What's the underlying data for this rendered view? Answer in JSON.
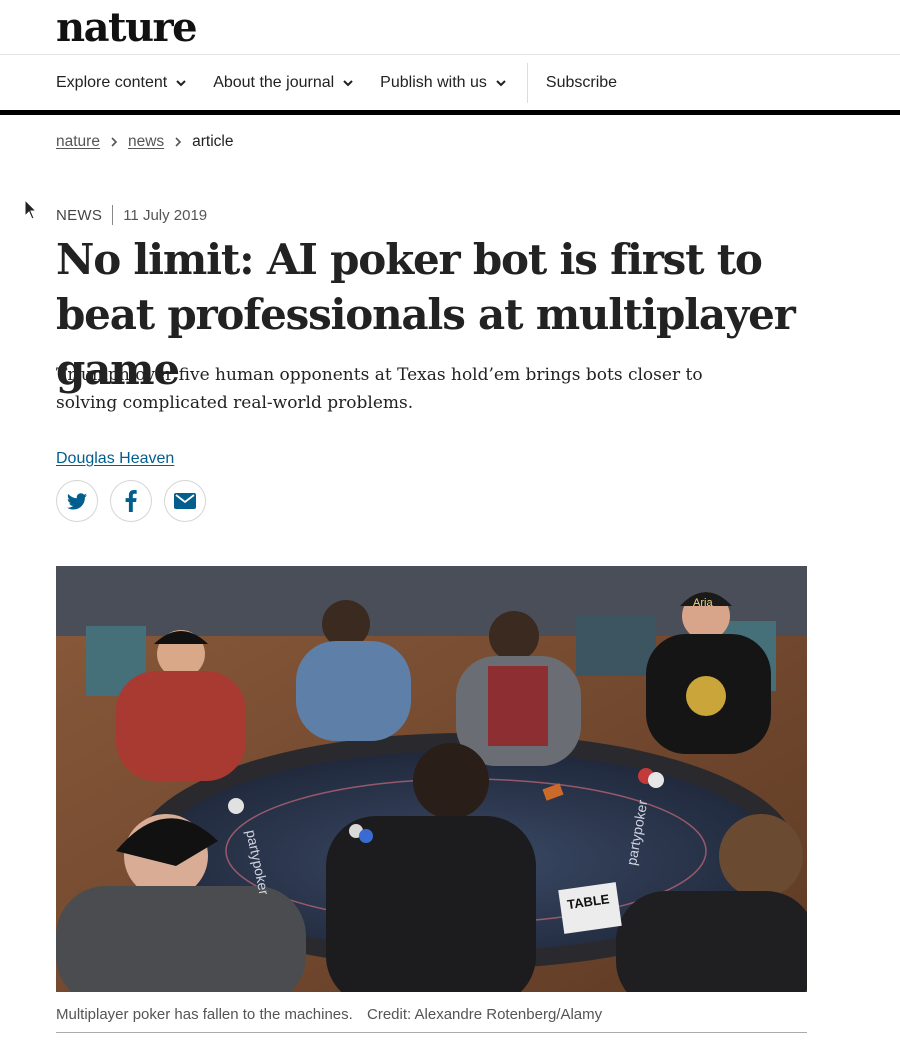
{
  "header": {
    "logo": "nature"
  },
  "nav": {
    "items": [
      {
        "label": "Explore content"
      },
      {
        "label": "About the journal"
      },
      {
        "label": "Publish with us"
      }
    ],
    "subscribe": "Subscribe"
  },
  "breadcrumb": {
    "home": "nature",
    "section": "news",
    "current": "article"
  },
  "article": {
    "type": "NEWS",
    "date": "11 July 2019",
    "title": "No limit: AI poker bot is first to beat professionals at multiplayer game",
    "standfirst": "Triumph over five human opponents at Texas hold’em brings bots closer to solving complicated real-world problems.",
    "author": "Douglas Heaven"
  },
  "share": {
    "icons": [
      "twitter-icon",
      "facebook-icon",
      "email-icon"
    ],
    "brand_color": "#025e8d"
  },
  "figure": {
    "caption": "Multiplayer poker has fallen to the machines.",
    "credit": "Credit: Alexandre Rotenberg/Alamy",
    "table_sign": "TABLE",
    "felt_logo": "partypoker",
    "cap_text": "Aria"
  }
}
